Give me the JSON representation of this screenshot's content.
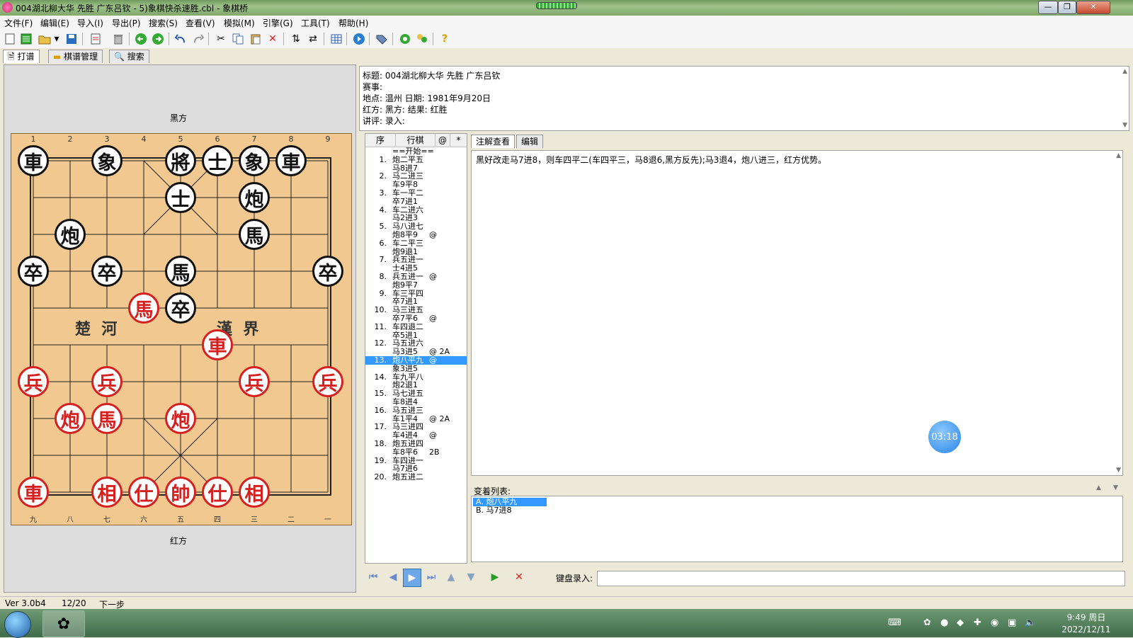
{
  "window": {
    "title": "004湖北柳大华 先胜 广东吕钦 - 5)象棋快杀速胜.cbl - 象棋桥",
    "btn_min": "—",
    "btn_max": "❐",
    "btn_close": "✕"
  },
  "menu": [
    "文件(F)",
    "编辑(E)",
    "导入(I)",
    "导出(P)",
    "搜索(S)",
    "查看(V)",
    "模拟(M)",
    "引擎(G)",
    "工具(T)",
    "帮助(H)"
  ],
  "tabs": [
    "打谱",
    "棋谱管理",
    "搜索"
  ],
  "board": {
    "top_label": "黑方",
    "bottom_label": "红方",
    "file_top": [
      "1",
      "2",
      "3",
      "4",
      "5",
      "6",
      "7",
      "8",
      "9"
    ],
    "file_bottom": [
      "九",
      "八",
      "七",
      "六",
      "五",
      "四",
      "三",
      "二",
      "一"
    ],
    "river_left": "楚  河",
    "river_right": "漢  界",
    "pieces": [
      {
        "c": "black",
        "t": "車",
        "col": 0,
        "row": 0
      },
      {
        "c": "black",
        "t": "象",
        "col": 2,
        "row": 0
      },
      {
        "c": "black",
        "t": "將",
        "col": 4,
        "row": 0
      },
      {
        "c": "black",
        "t": "士",
        "col": 5,
        "row": 0
      },
      {
        "c": "black",
        "t": "象",
        "col": 6,
        "row": 0
      },
      {
        "c": "black",
        "t": "車",
        "col": 7,
        "row": 0
      },
      {
        "c": "black",
        "t": "士",
        "col": 4,
        "row": 1
      },
      {
        "c": "black",
        "t": "炮",
        "col": 6,
        "row": 1
      },
      {
        "c": "black",
        "t": "炮",
        "col": 1,
        "row": 2
      },
      {
        "c": "black",
        "t": "馬",
        "col": 6,
        "row": 2
      },
      {
        "c": "black",
        "t": "卒",
        "col": 0,
        "row": 3
      },
      {
        "c": "black",
        "t": "卒",
        "col": 2,
        "row": 3
      },
      {
        "c": "black",
        "t": "馬",
        "col": 4,
        "row": 3
      },
      {
        "c": "black",
        "t": "卒",
        "col": 8,
        "row": 3
      },
      {
        "c": "red",
        "t": "馬",
        "col": 3,
        "row": 4
      },
      {
        "c": "black",
        "t": "卒",
        "col": 4,
        "row": 4
      },
      {
        "c": "red",
        "t": "車",
        "col": 5,
        "row": 5
      },
      {
        "c": "red",
        "t": "兵",
        "col": 0,
        "row": 6
      },
      {
        "c": "red",
        "t": "兵",
        "col": 2,
        "row": 6
      },
      {
        "c": "red",
        "t": "兵",
        "col": 6,
        "row": 6
      },
      {
        "c": "red",
        "t": "兵",
        "col": 8,
        "row": 6
      },
      {
        "c": "red",
        "t": "炮",
        "col": 1,
        "row": 7
      },
      {
        "c": "red",
        "t": "馬",
        "col": 2,
        "row": 7
      },
      {
        "c": "red",
        "t": "炮",
        "col": 4,
        "row": 7
      },
      {
        "c": "red",
        "t": "車",
        "col": 0,
        "row": 9
      },
      {
        "c": "red",
        "t": "相",
        "col": 2,
        "row": 9
      },
      {
        "c": "red",
        "t": "仕",
        "col": 3,
        "row": 9
      },
      {
        "c": "red",
        "t": "帥",
        "col": 4,
        "row": 9
      },
      {
        "c": "red",
        "t": "仕",
        "col": 5,
        "row": 9
      },
      {
        "c": "red",
        "t": "相",
        "col": 6,
        "row": 9
      }
    ]
  },
  "info": {
    "title": "标题: 004湖北柳大华 先胜 广东吕钦",
    "event": "赛事:",
    "place_date": "地点: 温州    日期: 1981年9月20日",
    "players": "红方:      黑方:       结果: 红胜",
    "commentary": "讲评:      录入:"
  },
  "moves": {
    "headers": [
      "序",
      "行棋",
      "@",
      "*"
    ],
    "rows": [
      {
        "n": "",
        "m": "==开始==",
        "f": ""
      },
      {
        "n": "1.",
        "m": "炮二平五",
        "f": ""
      },
      {
        "n": "",
        "m": "马8进7",
        "f": ""
      },
      {
        "n": "2.",
        "m": "马二进三",
        "f": ""
      },
      {
        "n": "",
        "m": "车9平8",
        "f": ""
      },
      {
        "n": "3.",
        "m": "车一平二",
        "f": ""
      },
      {
        "n": "",
        "m": "卒7进1",
        "f": ""
      },
      {
        "n": "4.",
        "m": "车二进六",
        "f": ""
      },
      {
        "n": "",
        "m": "马2进3",
        "f": ""
      },
      {
        "n": "5.",
        "m": "马八进七",
        "f": ""
      },
      {
        "n": "",
        "m": "炮8平9",
        "f": "@"
      },
      {
        "n": "6.",
        "m": "车二平三",
        "f": ""
      },
      {
        "n": "",
        "m": "炮9退1",
        "f": ""
      },
      {
        "n": "7.",
        "m": "兵五进一",
        "f": ""
      },
      {
        "n": "",
        "m": "士4进5",
        "f": ""
      },
      {
        "n": "8.",
        "m": "兵五进一",
        "f": "@"
      },
      {
        "n": "",
        "m": "炮9平7",
        "f": ""
      },
      {
        "n": "9.",
        "m": "车三平四",
        "f": ""
      },
      {
        "n": "",
        "m": "卒7进1",
        "f": ""
      },
      {
        "n": "10.",
        "m": "马三进五",
        "f": ""
      },
      {
        "n": "",
        "m": "卒7平6",
        "f": "@"
      },
      {
        "n": "11.",
        "m": "车四退二",
        "f": ""
      },
      {
        "n": "",
        "m": "卒5进1",
        "f": ""
      },
      {
        "n": "12.",
        "m": "马五进六",
        "f": ""
      },
      {
        "n": "",
        "m": "马3进5",
        "f": "@ 2A"
      },
      {
        "n": "13.",
        "m": "炮八平九",
        "f": "@",
        "sel": true
      },
      {
        "n": "",
        "m": "象3进5",
        "f": ""
      },
      {
        "n": "14.",
        "m": "车九平八",
        "f": ""
      },
      {
        "n": "",
        "m": "炮2退1",
        "f": ""
      },
      {
        "n": "15.",
        "m": "马七进五",
        "f": ""
      },
      {
        "n": "",
        "m": "车8进4",
        "f": ""
      },
      {
        "n": "16.",
        "m": "马五进三",
        "f": ""
      },
      {
        "n": "",
        "m": "车1平4",
        "f": "@ 2A"
      },
      {
        "n": "17.",
        "m": "马三进四",
        "f": ""
      },
      {
        "n": "",
        "m": "车4进4",
        "f": "@"
      },
      {
        "n": "18.",
        "m": "炮五进四",
        "f": ""
      },
      {
        "n": "",
        "m": "车8平6",
        "f": "  2B"
      },
      {
        "n": "19.",
        "m": "车四进一",
        "f": ""
      },
      {
        "n": "",
        "m": "马7进6",
        "f": ""
      },
      {
        "n": "20.",
        "m": "炮五进二",
        "f": ""
      }
    ]
  },
  "comment": {
    "tabs": [
      "注解查看",
      "编辑"
    ],
    "text": "黑好改走马7进8，则车四平二(车四平三，马8退6,黑方反先);马3退4，炮八进三，红方优势。",
    "timer": "03:18"
  },
  "variations": {
    "label": "变着列表:",
    "items": [
      "A. 炮八平九",
      "B. 马7进8"
    ]
  },
  "nav": {
    "keyboard_label": "键盘录入:"
  },
  "status": {
    "version": "Ver 3.0b4",
    "position": "12/20",
    "hint": "下一步"
  },
  "taskbar": {
    "time": "9:49 周日",
    "date": "2022/12/11"
  },
  "colors": {
    "board": "#f0c890",
    "red_piece": "#d62020",
    "black_piece": "#111111",
    "selection": "#3399ff"
  }
}
